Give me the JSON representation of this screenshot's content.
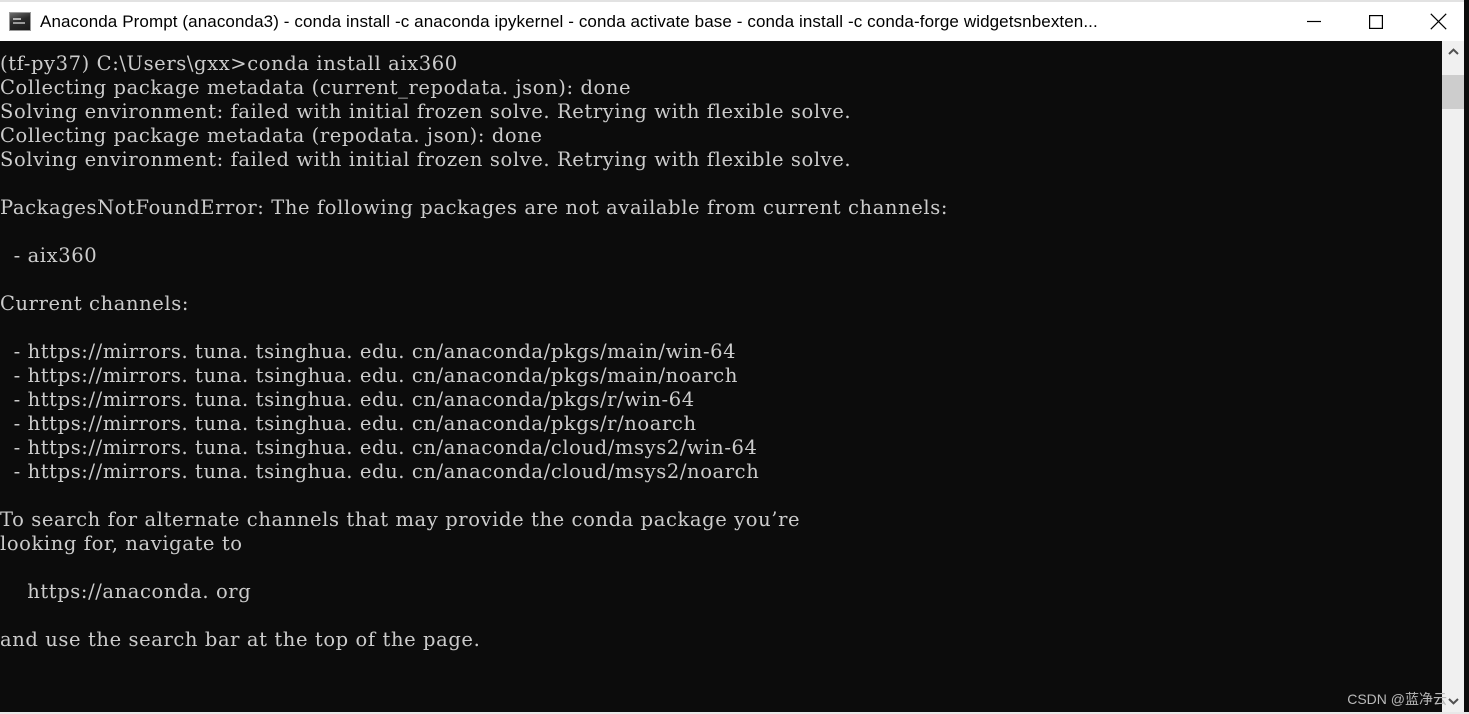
{
  "window": {
    "title": "Anaconda Prompt (anaconda3) - conda  install -c anaconda ipykernel - conda  activate base - conda  install -c conda-forge widgetsnbexten...",
    "icon": "console-icon",
    "controls": {
      "minimize_label": "Minimize",
      "maximize_label": "Maximize",
      "close_label": "Close"
    }
  },
  "console": {
    "prompt_env": "(tf-py37)",
    "prompt_path": "C:\\Users\\gxx>",
    "command": "conda install aix360",
    "text": "(tf-py37) C:\\Users\\gxx>conda install aix360\nCollecting package metadata (current_repodata. json): done\nSolving environment: failed with initial frozen solve. Retrying with flexible solve.\nCollecting package metadata (repodata. json): done\nSolving environment: failed with initial frozen solve. Retrying with flexible solve.\n\nPackagesNotFoundError: The following packages are not available from current channels:\n\n  - aix360\n\nCurrent channels:\n\n  - https://mirrors. tuna. tsinghua. edu. cn/anaconda/pkgs/main/win-64\n  - https://mirrors. tuna. tsinghua. edu. cn/anaconda/pkgs/main/noarch\n  - https://mirrors. tuna. tsinghua. edu. cn/anaconda/pkgs/r/win-64\n  - https://mirrors. tuna. tsinghua. edu. cn/anaconda/pkgs/r/noarch\n  - https://mirrors. tuna. tsinghua. edu. cn/anaconda/cloud/msys2/win-64\n  - https://mirrors. tuna. tsinghua. edu. cn/anaconda/cloud/msys2/noarch\n\nTo search for alternate channels that may provide the conda package you’re\nlooking for, navigate to\n\n    https://anaconda. org\n\nand use the search bar at the top of the page.",
    "lines": [
      "(tf-py37) C:\\Users\\gxx>conda install aix360",
      "Collecting package metadata (current_repodata. json): done",
      "Solving environment: failed with initial frozen solve. Retrying with flexible solve.",
      "Collecting package metadata (repodata. json): done",
      "Solving environment: failed with initial frozen solve. Retrying with flexible solve.",
      "",
      "PackagesNotFoundError: The following packages are not available from current channels:",
      "",
      "  - aix360",
      "",
      "Current channels:",
      "",
      "  - https://mirrors. tuna. tsinghua. edu. cn/anaconda/pkgs/main/win-64",
      "  - https://mirrors. tuna. tsinghua. edu. cn/anaconda/pkgs/main/noarch",
      "  - https://mirrors. tuna. tsinghua. edu. cn/anaconda/pkgs/r/win-64",
      "  - https://mirrors. tuna. tsinghua. edu. cn/anaconda/pkgs/r/noarch",
      "  - https://mirrors. tuna. tsinghua. edu. cn/anaconda/cloud/msys2/win-64",
      "  - https://mirrors. tuna. tsinghua. edu. cn/anaconda/cloud/msys2/noarch",
      "",
      "To search for alternate channels that may provide the conda package you’re",
      "looking for, navigate to",
      "",
      "    https://anaconda. org",
      "",
      "and use the search bar at the top of the page."
    ],
    "missing_package": "aix360",
    "error_name": "PackagesNotFoundError",
    "channels": [
      "https://mirrors. tuna. tsinghua. edu. cn/anaconda/pkgs/main/win-64",
      "https://mirrors. tuna. tsinghua. edu. cn/anaconda/pkgs/main/noarch",
      "https://mirrors. tuna. tsinghua. edu. cn/anaconda/pkgs/r/win-64",
      "https://mirrors. tuna. tsinghua. edu. cn/anaconda/pkgs/r/noarch",
      "https://mirrors. tuna. tsinghua. edu. cn/anaconda/cloud/msys2/win-64",
      "https://mirrors. tuna. tsinghua. edu. cn/anaconda/cloud/msys2/noarch"
    ],
    "help_url": "https://anaconda. org",
    "background_color": "#0c0c0c",
    "text_color": "#cccccc"
  },
  "scrollbar": {
    "up_arrow": "chevron-up-icon",
    "down_arrow": "chevron-down-icon",
    "thumb_color": "#cdcdcd",
    "track_color": "#f0f0f0"
  },
  "watermark": {
    "text": "CSDN @蓝净云"
  }
}
